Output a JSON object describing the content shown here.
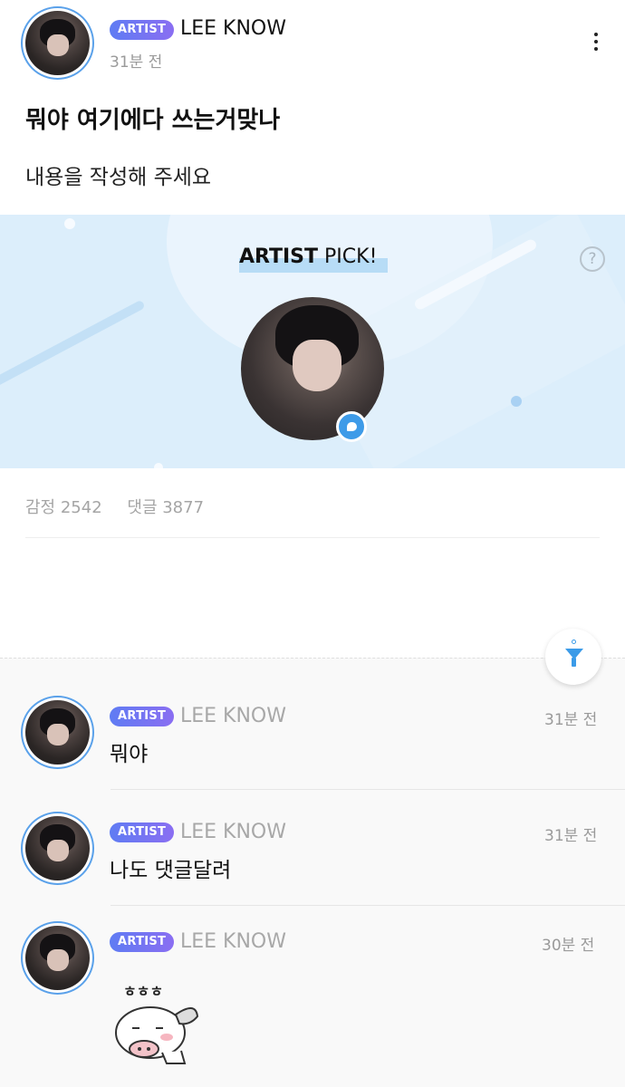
{
  "post": {
    "author_badge": "ARTIST",
    "author_name": "LEE KNOW",
    "time": "31분 전",
    "title": "뭐야 여기에다 쓰는거맞나",
    "body": "내용을 작성해 주세요"
  },
  "artist_pick": {
    "title_bold": "ARTIST",
    "title_rest": " PICK!",
    "help": "?"
  },
  "stats": {
    "emotion": "감정 2542",
    "comments": "댓글 3877"
  },
  "comments": [
    {
      "badge": "ARTIST",
      "name": "LEE KNOW",
      "time": "31분 전",
      "text": "뭐야"
    },
    {
      "badge": "ARTIST",
      "name": "LEE KNOW",
      "time": "31분 전",
      "text": "나도 댓글달려"
    },
    {
      "badge": "ARTIST",
      "name": "LEE KNOW",
      "time": "30분 전",
      "sticker": "cow-sticker",
      "sticker_text": "ㅎㅎㅎ"
    }
  ],
  "icons": {
    "menu": "kebab-menu-icon",
    "help": "help-icon",
    "chat": "chat-bubble-icon",
    "filter": "filter-icon"
  },
  "colors": {
    "badge_start": "#5f7cf3",
    "badge_end": "#8a6ef2",
    "accent": "#3b9be8",
    "banner_bg": "#dceefb"
  }
}
